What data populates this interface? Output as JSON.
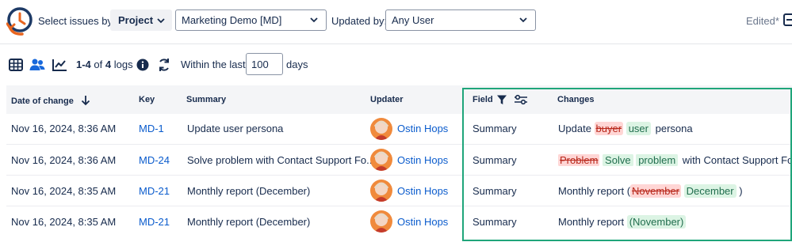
{
  "header": {
    "select_issues_label": "Select issues by:",
    "project_button_label": "Project",
    "project_select_value": "Marketing Demo [MD]",
    "updated_by_label": "Updated by:",
    "updated_by_value": "Any User",
    "edited_label": "Edited*"
  },
  "toolbar": {
    "range_bold": "1-4",
    "range_of": "of",
    "total_bold": "4",
    "logs_label": "logs",
    "within_label": "Within the last:",
    "days_value": "100",
    "days_label": "days"
  },
  "table": {
    "headers": {
      "date": "Date of change",
      "key": "Key",
      "summary": "Summary",
      "updater": "Updater",
      "field": "Field",
      "changes": "Changes"
    },
    "rows": [
      {
        "date": "Nov 16, 2024, 8:36 AM",
        "key": "MD-1",
        "summary": "Update user persona",
        "updater": "Ostin Hops",
        "field": "Summary",
        "changes": {
          "t1": "Update",
          "del1": "buyer",
          "ins1": "user",
          "t2": "persona"
        }
      },
      {
        "date": "Nov 16, 2024, 8:36 AM",
        "key": "MD-24",
        "summary": "Solve problem with Contact Support Fo...",
        "updater": "Ostin Hops",
        "field": "Summary",
        "changes": {
          "del1": "Problem",
          "ins1": "Solve",
          "ins2": "problem",
          "t1": "with Contact Support Form"
        }
      },
      {
        "date": "Nov 16, 2024, 8:35 AM",
        "key": "MD-21",
        "summary": "Monthly report (December)",
        "updater": "Ostin Hops",
        "field": "Summary",
        "changes": {
          "t1": "Monthly report (",
          "del1": "November",
          "ins1": "December",
          "t2": ")"
        }
      },
      {
        "date": "Nov 16, 2024, 8:35 AM",
        "key": "MD-21",
        "summary": "Monthly report (December)",
        "updater": "Ostin Hops",
        "field": "Summary",
        "changes": {
          "t1": "Monthly report",
          "ins1": "(November)"
        }
      }
    ]
  },
  "colors": {
    "accent_blue": "#0b5ccd",
    "highlight_green": "#1fa57a",
    "deleted_bg": "#ffd6d5",
    "inserted_bg": "#dcf4e4"
  },
  "icons": [
    "history-clock-icon",
    "chevron-down-icon",
    "table-view-icon",
    "users-view-icon",
    "chart-view-icon",
    "info-icon",
    "refresh-icon",
    "sort-down-arrow-icon",
    "filter-icon",
    "sliders-icon",
    "export-icon"
  ]
}
